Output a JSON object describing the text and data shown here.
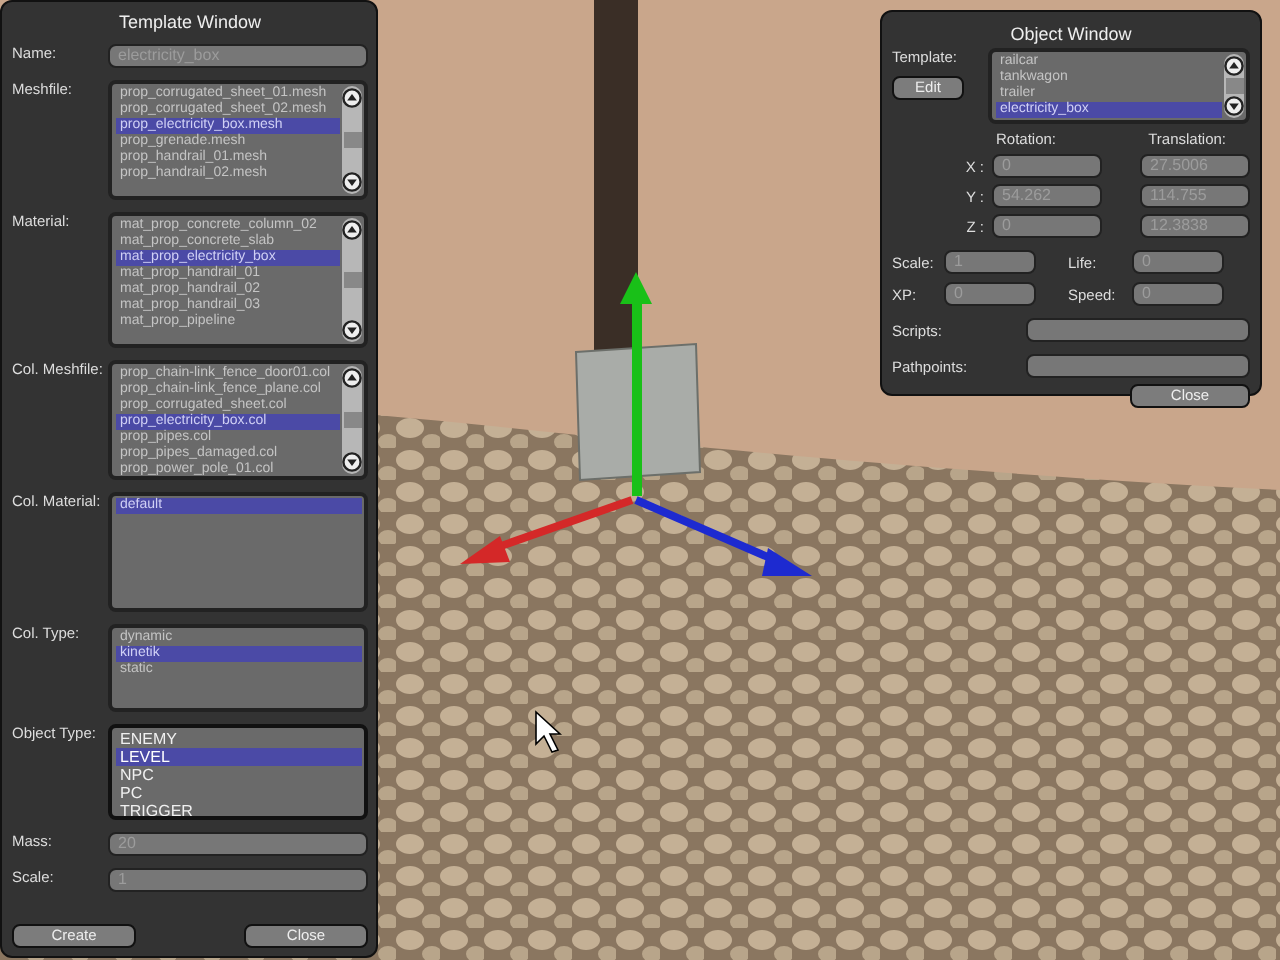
{
  "template_window": {
    "title": "Template Window",
    "name": {
      "label": "Name:",
      "value": "electricity_box"
    },
    "lists": [
      {
        "label": "Meshfile:",
        "scrollbar": true,
        "items": [
          {
            "text": "prop_corrugated_sheet_01.mesh",
            "selected": false
          },
          {
            "text": "prop_corrugated_sheet_02.mesh",
            "selected": false
          },
          {
            "text": "prop_electricity_box.mesh",
            "selected": true
          },
          {
            "text": "prop_grenade.mesh",
            "selected": false
          },
          {
            "text": "prop_handrail_01.mesh",
            "selected": false
          },
          {
            "text": "prop_handrail_02.mesh",
            "selected": false
          }
        ]
      },
      {
        "label": "Material:",
        "scrollbar": true,
        "items": [
          {
            "text": "mat_prop_concrete_column_02",
            "selected": false
          },
          {
            "text": "mat_prop_concrete_slab",
            "selected": false
          },
          {
            "text": "mat_prop_electricity_box",
            "selected": true
          },
          {
            "text": "mat_prop_handrail_01",
            "selected": false
          },
          {
            "text": "mat_prop_handrail_02",
            "selected": false
          },
          {
            "text": "mat_prop_handrail_03",
            "selected": false
          },
          {
            "text": "mat_prop_pipeline",
            "selected": false
          }
        ]
      },
      {
        "label": "Col. Meshfile:",
        "scrollbar": true,
        "items": [
          {
            "text": "prop_chain-link_fence_door01.col",
            "selected": false
          },
          {
            "text": "prop_chain-link_fence_plane.col",
            "selected": false
          },
          {
            "text": "prop_corrugated_sheet.col",
            "selected": false
          },
          {
            "text": "prop_electricity_box.col",
            "selected": true
          },
          {
            "text": "prop_pipes.col",
            "selected": false
          },
          {
            "text": "prop_pipes_damaged.col",
            "selected": false
          },
          {
            "text": "prop_power_pole_01.col",
            "selected": false
          }
        ]
      },
      {
        "label": "Col. Material:",
        "scrollbar": false,
        "items": [
          {
            "text": "default",
            "selected": true
          }
        ]
      },
      {
        "label": "Col. Type:",
        "scrollbar": false,
        "items": [
          {
            "text": "dynamic",
            "selected": false
          },
          {
            "text": "kinetik",
            "selected": true
          },
          {
            "text": "static",
            "selected": false
          }
        ]
      },
      {
        "label": "Object Type:",
        "scrollbar": false,
        "items": [
          {
            "text": "ENEMY",
            "selected": false
          },
          {
            "text": "LEVEL",
            "selected": true
          },
          {
            "text": "NPC",
            "selected": false
          },
          {
            "text": "PC",
            "selected": false
          },
          {
            "text": "TRIGGER",
            "selected": false
          }
        ]
      }
    ],
    "fields": [
      {
        "label": "Mass:",
        "value": "20"
      },
      {
        "label": "Scale:",
        "value": "1"
      }
    ],
    "buttons": [
      "Create",
      "Close"
    ]
  },
  "object_window": {
    "title": "Object Window",
    "template": {
      "label": "Template:",
      "button": "Edit",
      "items": [
        {
          "text": "railcar",
          "selected": false
        },
        {
          "text": "tankwagon",
          "selected": false
        },
        {
          "text": "trailer",
          "selected": false
        },
        {
          "text": "electricity_box",
          "selected": true
        }
      ]
    },
    "rotation_label": "Rotation:",
    "translation_label": "Translation:",
    "axes": [
      {
        "label": "X :",
        "rotation": "0",
        "translation": "27.5006"
      },
      {
        "label": "Y :",
        "rotation": "54.262",
        "translation": "114.755"
      },
      {
        "label": "Z :",
        "rotation": "0",
        "translation": "12.3838"
      }
    ],
    "stats": [
      {
        "label": "Scale:",
        "value": "1",
        "label2": "Life:",
        "value2": "0"
      },
      {
        "label": "XP:",
        "value": "0",
        "label2": "Speed:",
        "value2": "0"
      }
    ],
    "wide_fields": [
      {
        "label": "Scripts:"
      },
      {
        "label": "Pathpoints:"
      }
    ],
    "close": "Close"
  }
}
